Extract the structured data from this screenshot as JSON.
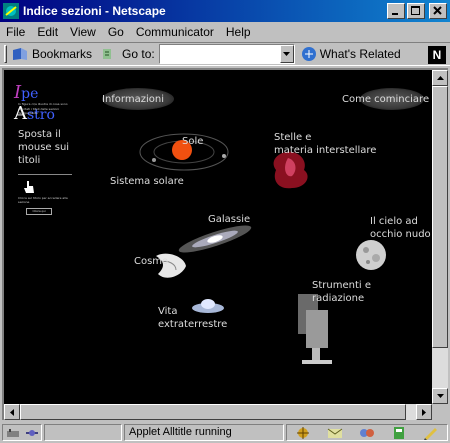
{
  "window": {
    "title": "Indice sezioni - Netscape"
  },
  "menu": [
    "File",
    "Edit",
    "View",
    "Go",
    "Communicator",
    "Help"
  ],
  "toolbar": {
    "bookmarks_label": "Bookmarks",
    "goto_label": "Go to:",
    "goto_value": "",
    "related_label": "What's Related",
    "logo_letter": "N"
  },
  "left_frame": {
    "logo_part1": "I",
    "logo_part2": "pe",
    "logo_part3": "A",
    "logo_part4": "stro",
    "tiny_text": "In figura ci/a illustra di cosa sono riportati i titoli delle sezioni dell'Ipertesto",
    "hint": "Sposta il mouse sui titoli",
    "tiny_text2": "Clicca sul titolo per accedere alla sezione",
    "small_button": "Clicca qui"
  },
  "sections": {
    "informazioni": "Informazioni",
    "come_cominciare": "Come cominciare",
    "sole": "Sole",
    "sistema_solare": "Sistema solare",
    "stelle_line1": "Stelle  e",
    "stelle_line2": "materia interstellare",
    "galassie": "Galassie",
    "cielo_line1": "Il cielo ad",
    "cielo_line2": "occhio nudo",
    "cosmo": "Cosmo",
    "strumenti_line1": "Strumenti e",
    "strumenti_line2": "radiazione",
    "vita_line1": "Vita",
    "vita_line2": "extraterrestre"
  },
  "status": {
    "text": "Applet Alltitle running"
  }
}
